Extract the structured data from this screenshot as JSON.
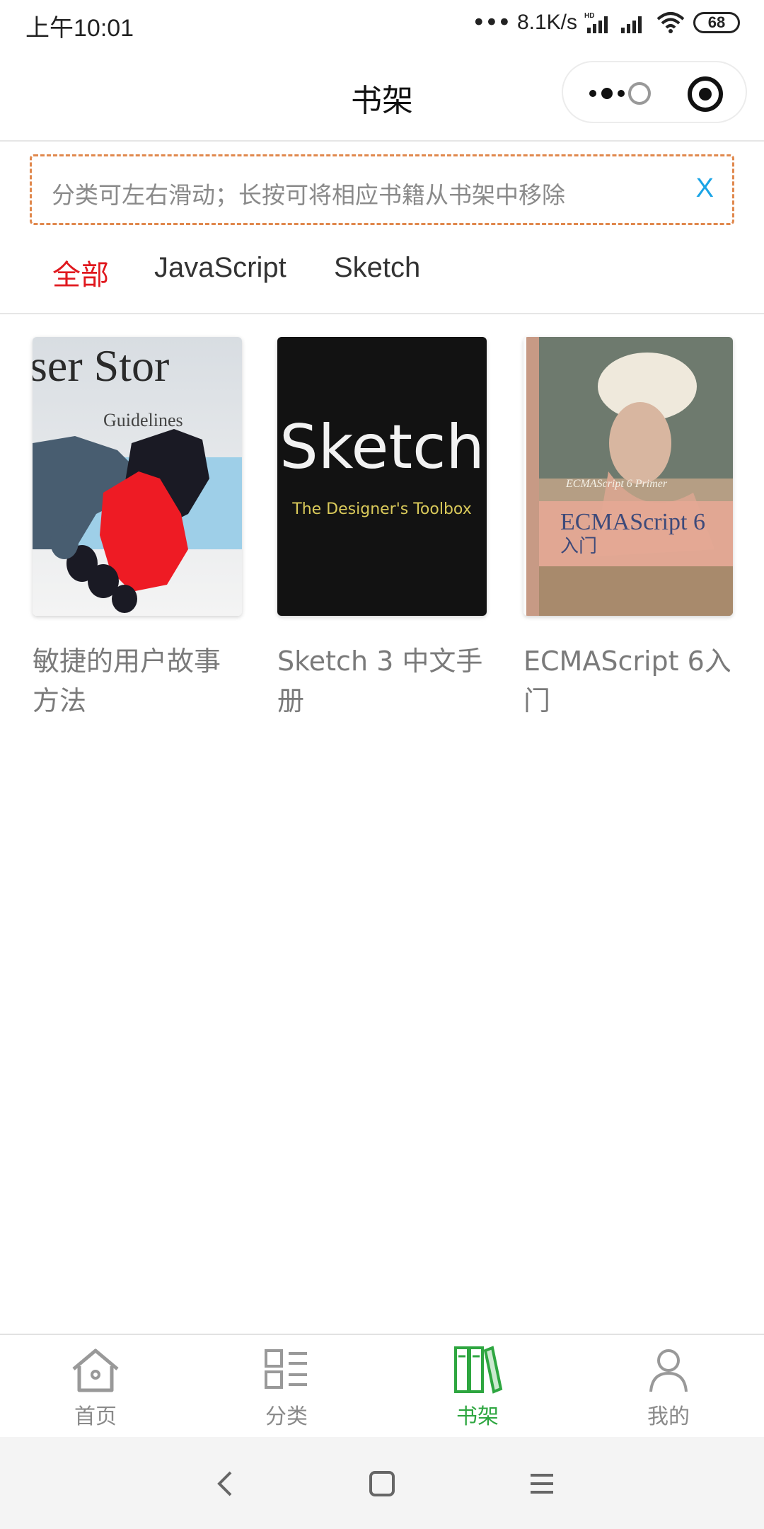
{
  "status_bar": {
    "time": "上午10:01",
    "dots": "•••",
    "net_speed": "8.1K/s",
    "battery": "68"
  },
  "header": {
    "title": "书架"
  },
  "tip": {
    "text": "分类可左右滑动；长按可将相应书籍从书架中移除",
    "close_label": "X"
  },
  "categories": [
    {
      "label": "全部",
      "active": true
    },
    {
      "label": "JavaScript",
      "active": false
    },
    {
      "label": "Sketch",
      "active": false
    }
  ],
  "books": [
    {
      "title": "敏捷的用户故事方法",
      "cover_text_1": "ser Stor",
      "cover_text_2": "Guidelines"
    },
    {
      "title": "Sketch 3 中文手册",
      "cover_text_1": "Sketch",
      "cover_text_2": "The Designer's Toolbox"
    },
    {
      "title": "ECMAScript 6入门",
      "cover_text_1": "ECMAScript 6 Primer",
      "cover_text_2": "ECMAScript 6",
      "cover_text_3": "入门"
    }
  ],
  "tabbar": [
    {
      "label": "首页",
      "icon": "home-icon",
      "active": false
    },
    {
      "label": "分类",
      "icon": "category-icon",
      "active": false
    },
    {
      "label": "书架",
      "icon": "bookshelf-icon",
      "active": true
    },
    {
      "label": "我的",
      "icon": "user-icon",
      "active": false
    }
  ],
  "colors": {
    "accent_red": "#e0181e",
    "tab_active_green": "#2ea640",
    "tip_border": "#e0884d",
    "tip_close": "#1aa4e6"
  }
}
